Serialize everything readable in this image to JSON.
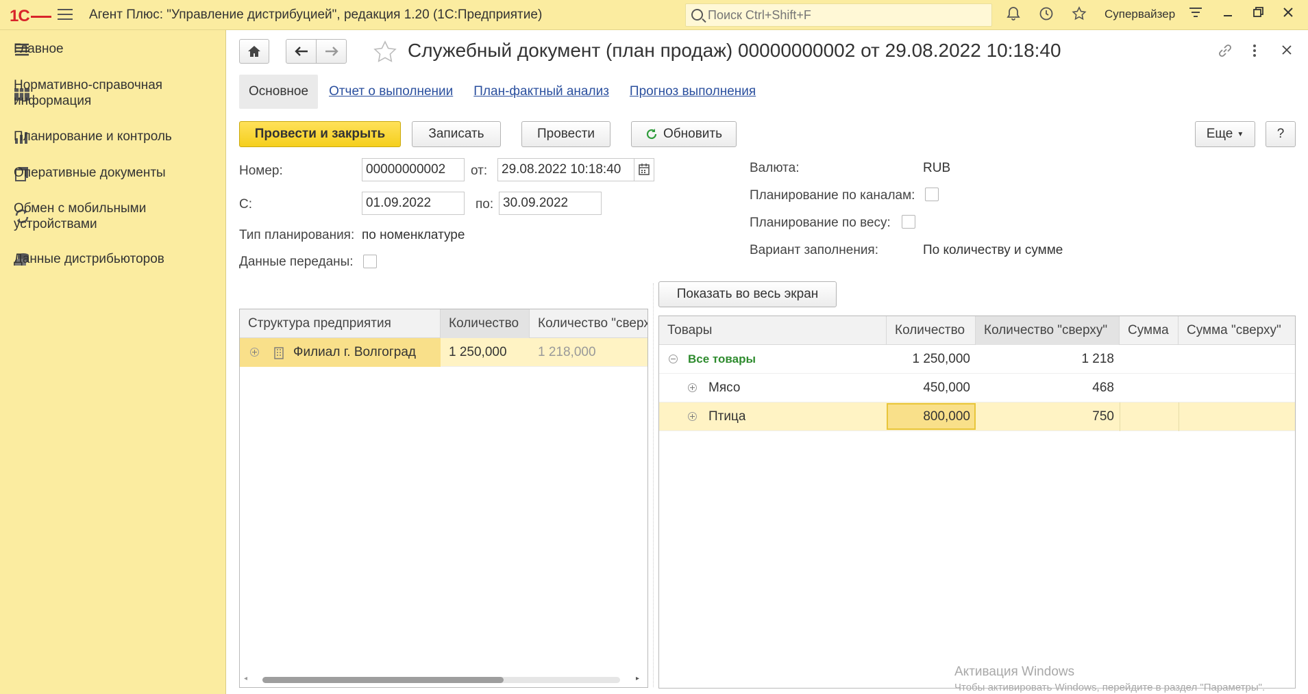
{
  "app": {
    "logo": "1С",
    "title": "Агент Плюс: \"Управление дистрибуцией\", редакция 1.20  (1С:Предприятие)",
    "search_placeholder": "Поиск Ctrl+Shift+F",
    "user": "Супервайзер"
  },
  "sidebar": {
    "items": [
      {
        "label": "Главное",
        "icon": "list-icon"
      },
      {
        "label": "Нормативно-справочная информация",
        "icon": "catalog-icon"
      },
      {
        "label": "Планирование и контроль",
        "icon": "chart-icon"
      },
      {
        "label": "Оперативные документы",
        "icon": "documents-icon"
      },
      {
        "label": "Обмен с мобильными устройствами",
        "icon": "sync-icon"
      },
      {
        "label": "Данные дистрибьюторов",
        "icon": "database-icon"
      }
    ]
  },
  "document": {
    "title": "Служебный документ (план продаж) 00000000002 от 29.08.2022 10:18:40",
    "tabs": [
      {
        "label": "Основное",
        "active": true
      },
      {
        "label": "Отчет о выполнении",
        "active": false
      },
      {
        "label": "План-фактный анализ",
        "active": false
      },
      {
        "label": "Прогноз выполнения",
        "active": false
      }
    ]
  },
  "toolbar": {
    "post_close": "Провести и закрыть",
    "save": "Записать",
    "post": "Провести",
    "refresh": "Обновить",
    "more": "Еще",
    "help": "?"
  },
  "form": {
    "number_label": "Номер:",
    "number_value": "00000000002",
    "from_label": "от:",
    "from_value": "29.08.2022 10:18:40",
    "start_label": "С:",
    "start_value": "01.09.2022",
    "end_label": "по:",
    "end_value": "30.09.2022",
    "planning_type_label": "Тип планирования:",
    "planning_type_value": "по номенклатуре",
    "data_sent_label": "Данные переданы:",
    "currency_label": "Валюта:",
    "currency_value": "RUB",
    "by_channels_label": "Планирование по каналам:",
    "by_weight_label": "Планирование по весу:",
    "fill_variant_label": "Вариант заполнения:",
    "fill_variant_value": "По количеству и сумме",
    "fullscreen_button": "Показать во весь экран"
  },
  "left_table": {
    "headers": [
      "Структура предприятия",
      "Количество",
      "Количество \"сверху\""
    ],
    "rows": [
      {
        "name": "Филиал г. Волгоград",
        "qty": "1 250,000",
        "qty_top": "1 218,000"
      }
    ]
  },
  "right_table": {
    "headers": [
      "Товары",
      "Количество",
      "Количество \"сверху\"",
      "Сумма",
      "Сумма \"сверху\""
    ],
    "rows": [
      {
        "name": "Все товары",
        "qty": "1 250,000",
        "qty_top": "1 218",
        "sum": "",
        "sum_top": ""
      },
      {
        "name": "Мясо",
        "qty": "450,000",
        "qty_top": "468",
        "sum": "",
        "sum_top": ""
      },
      {
        "name": "Птица",
        "qty": "800,000",
        "qty_top": "750",
        "sum": "",
        "sum_top": ""
      }
    ]
  },
  "watermark": {
    "line1": "Активация Windows",
    "line2": "Чтобы активировать Windows, перейдите в раздел \"Параметры\"."
  },
  "colors": {
    "accent_yellow": "#fbeca0",
    "primary_button": "#f5cf1d",
    "link": "#2a4f9e",
    "group_green": "#2e8b2e",
    "selected_row": "#fff3c4"
  }
}
